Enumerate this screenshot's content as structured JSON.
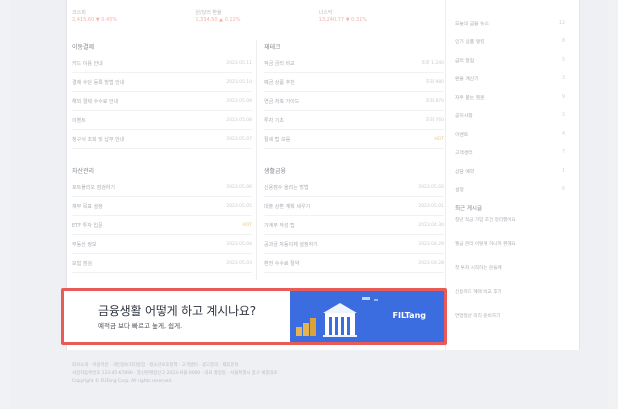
{
  "top_row": [
    {
      "label": "코스피",
      "sub": "2,415.60 ▼ 0.45%"
    },
    {
      "label": "원/달러 환율",
      "sub": "1,334.50 ▲ 0.12%"
    },
    {
      "label": "나스닥",
      "sub": "13,240.77 ▼ 0.31%"
    }
  ],
  "sections": [
    {
      "title": "이동결제",
      "rows": [
        {
          "text": "카드 이용 안내",
          "meta": "2023.05.11"
        },
        {
          "text": "결제 수단 등록 방법 안내",
          "meta": "2023.05.10"
        },
        {
          "text": "해외 결제 수수료 안내",
          "meta": "2023.05.09"
        },
        {
          "text": "이벤트",
          "meta": "2023.05.08"
        },
        {
          "text": "청구서 조회 및 납부 안내",
          "meta": "2023.05.07"
        }
      ]
    },
    {
      "title": "재테크",
      "rows": [
        {
          "text": "적금 금리 비교",
          "meta": "조회 1,240"
        },
        {
          "text": "예금 상품 추천",
          "meta": "조회 980"
        },
        {
          "text": "연금 저축 가이드",
          "meta": "조회 870"
        },
        {
          "text": "투자 기초",
          "meta": "조회 760"
        },
        {
          "text": "절세 팁 모음",
          "meta": "HOT",
          "hot": true
        }
      ]
    },
    {
      "title": "자산관리",
      "rows": [
        {
          "text": "포트폴리오 점검하기",
          "meta": "2023.05.06"
        },
        {
          "text": "재무 목표 설정",
          "meta": "2023.05.05"
        },
        {
          "text": "ETF 투자 입문",
          "meta": "HOT",
          "hot": true
        },
        {
          "text": "부동산 정보",
          "meta": "2023.05.04"
        },
        {
          "text": "보험 점검",
          "meta": "2023.05.03"
        }
      ]
    },
    {
      "title": "생활금융",
      "rows": [
        {
          "text": "신용점수 올리는 방법",
          "meta": "2023.05.02"
        },
        {
          "text": "대출 상환 계획 세우기",
          "meta": "2023.05.01"
        },
        {
          "text": "가계부 작성 팁",
          "meta": "2023.04.30"
        },
        {
          "text": "공과금 자동이체 설정하기",
          "meta": "2023.04.29"
        },
        {
          "text": "환전 수수료 절약",
          "meta": "2023.04.28"
        }
      ]
    }
  ],
  "sidebar": {
    "items": [
      {
        "text": "오늘의 금융 뉴스",
        "n": "12"
      },
      {
        "text": "인기 상품 랭킹",
        "n": "8"
      },
      {
        "text": "금리 알림",
        "n": "5"
      },
      {
        "text": "환율 계산기",
        "n": "3"
      },
      {
        "text": "자주 묻는 질문",
        "n": "9"
      },
      {
        "text": "공지사항",
        "n": "2"
      },
      {
        "text": "이벤트",
        "n": "4"
      },
      {
        "text": "고객센터",
        "n": "7"
      },
      {
        "text": "상담 예약",
        "n": "1"
      },
      {
        "text": "설정",
        "n": "6"
      }
    ],
    "title": "최근 게시글",
    "posts": [
      "청년 적금 가입 조건 정리했어요",
      "월급 관리 이렇게 하니까 편해요",
      "첫 투자 시작하는 분들께",
      "신용카드 혜택 비교 후기",
      "연말정산 미리 준비하기"
    ]
  },
  "ad": {
    "headline": "금융생활 어떻게 하고 계시나요?",
    "subline": "예적금 보다 빠르고 높게, 쉽게.",
    "brand": "FILTang"
  },
  "footer": {
    "lines": [
      "회사소개 · 이용약관 · 개인정보처리방침 · 청소년보호정책 · 고객센터 · 광고문의 · 제휴문의",
      "사업자등록번호 123-45-67890 · 통신판매업신고 2023-서울-0000 · 대표 홍길동 · 서울특별시 중구 세종대로",
      "Copyright © FILTang Corp. All rights reserved."
    ]
  },
  "colors": {
    "ad_outline": "#e85b57",
    "ad_blue": "#3b6ce0"
  }
}
